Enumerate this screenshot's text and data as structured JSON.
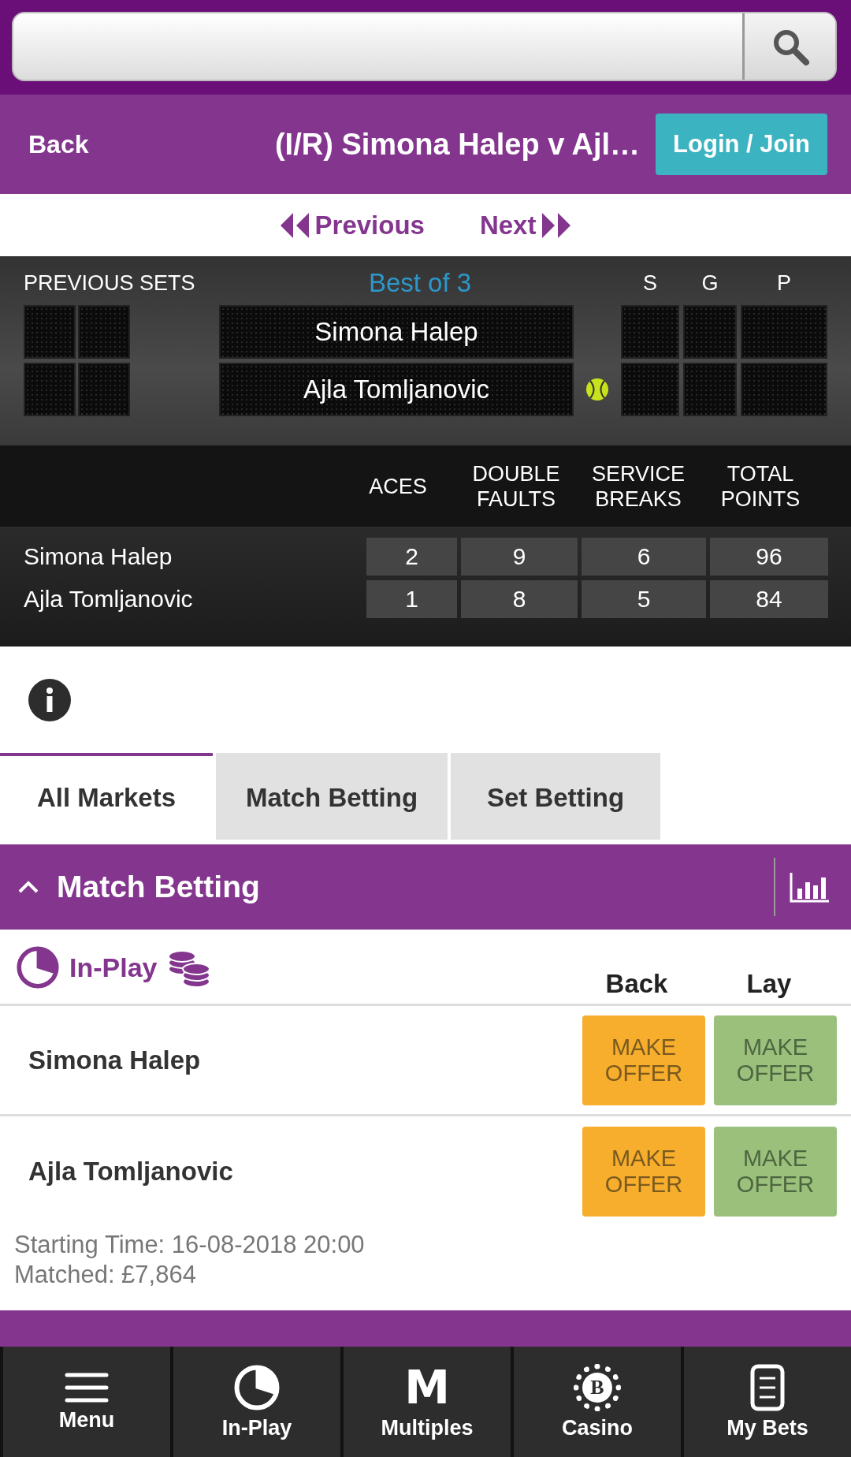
{
  "header": {
    "back": "Back",
    "title": "(I/R) Simona Halep v Ajl…",
    "login": "Login / Join"
  },
  "pager": {
    "previous": "Previous",
    "next": "Next"
  },
  "scoreboard": {
    "previous_sets_label": "PREVIOUS SETS",
    "format": "Best of 3",
    "score_columns": [
      "S",
      "G",
      "P"
    ],
    "players": [
      {
        "name": "Simona Halep",
        "serving": false
      },
      {
        "name": "Ajla Tomljanovic",
        "serving": true
      }
    ]
  },
  "stats": {
    "columns": [
      "ACES",
      "DOUBLE FAULTS",
      "SERVICE BREAKS",
      "TOTAL POINTS"
    ],
    "rows": [
      {
        "name": "Simona Halep",
        "values": [
          "2",
          "9",
          "6",
          "96"
        ]
      },
      {
        "name": "Ajla Tomljanovic",
        "values": [
          "1",
          "8",
          "5",
          "84"
        ]
      }
    ]
  },
  "tabs": [
    {
      "label": "All Markets",
      "selected": true
    },
    {
      "label": "Match Betting",
      "selected": false
    },
    {
      "label": "Set Betting",
      "selected": false
    }
  ],
  "market": {
    "title": "Match Betting",
    "expanded": true,
    "status": "In-Play",
    "columns": [
      "Back",
      "Lay"
    ],
    "runners": [
      {
        "name": "Simona Halep",
        "back": "MAKE OFFER",
        "lay": "MAKE OFFER"
      },
      {
        "name": "Ajla Tomljanovic",
        "back": "MAKE OFFER",
        "lay": "MAKE OFFER"
      }
    ],
    "starting_time": "Starting Time: 16-08-2018 20:00",
    "matched": "Matched: £7,864"
  },
  "nav": [
    {
      "label": "Menu",
      "kind": "menu"
    },
    {
      "label": "In-Play",
      "kind": "inplay"
    },
    {
      "label": "Multiples",
      "kind": "glyph",
      "glyph": "M"
    },
    {
      "label": "Casino",
      "kind": "chip",
      "glyph": "B"
    },
    {
      "label": "My Bets",
      "kind": "slip"
    }
  ]
}
